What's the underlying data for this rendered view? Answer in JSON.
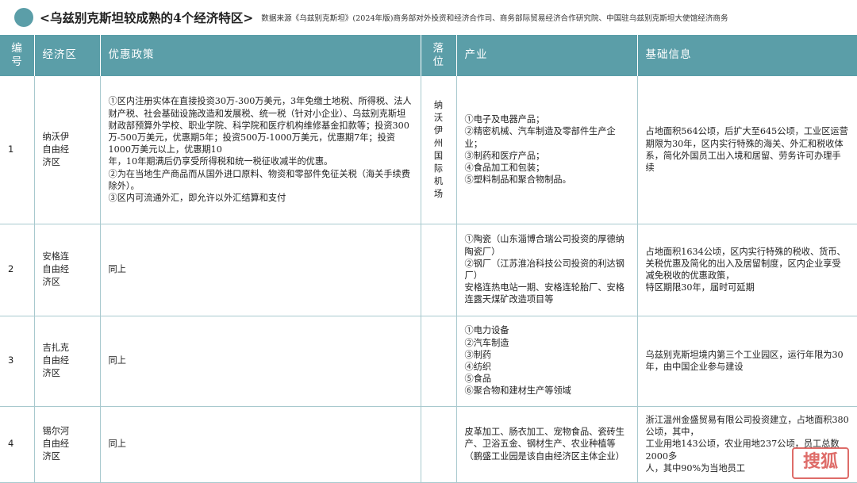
{
  "header": {
    "title": "<乌兹别克斯坦较成熟的4个经济特区>",
    "source": "数据来源《乌兹别克斯坦》(2024年版)商务部对外投资和经济合作司、商务部际贸易经济合作研究院、中国驻乌兹别克斯坦大使馆经济商务"
  },
  "columns": {
    "no": "编号",
    "zone": "经济区",
    "policy": "优惠政策",
    "location": "落位",
    "industry": "产业",
    "basic": "基础信息"
  },
  "rows": [
    {
      "no": "1",
      "zone": [
        "纳沃伊",
        "自由经",
        "济区"
      ],
      "policy": [
        "①区内注册实体在直接投资30万-300万美元，3年免缴土地税、所得税、法人财产税、社会基础设施改造和发展税、统一税（针对小企业）、乌兹别克斯坦财政部预算外学校、职业学院、科学院和医疗机构维修基金扣款等；投资300万-500万美元，优惠期5年；投资500万-1000万美元，优惠期7年；投资1000万美元以上，优惠期10",
        "年，10年期满后仍享受所得税和统一税征收减半的优惠。",
        "②为在当地生产商品而从国外进口原料、物资和零部件免征关税（海关手续费除外）。",
        "③区内可流通外汇，即允许以外汇结算和支付"
      ],
      "location": [
        "纳",
        "沃",
        "伊",
        "州",
        "国",
        "际",
        "机",
        "场"
      ],
      "industry": [
        "①电子及电器产品；",
        "②精密机械、汽车制造及零部件生产企业；",
        "③制药和医疗产品；",
        "④食品加工和包装；",
        "⑤塑料制品和聚合物制品。"
      ],
      "basic": [
        "占地面积564公顷，后扩大至645公顷，工业区运营期限为30年，区内实行特殊的海关、外汇和税收体系，简化外国员工出入境和居留、劳务许可办理手续"
      ]
    },
    {
      "no": "2",
      "zone": [
        "安格连",
        "自由经",
        "济区"
      ],
      "policy": [
        "同上"
      ],
      "location": [],
      "industry": [
        "①陶瓷（山东淄博合瑞公司投资的厚德纳陶瓷厂）",
        "②钢厂（江苏淮冶科技公司投资的利达钢厂）",
        "安格连热电站一期、安格连轮胎厂、安格连露天煤矿改造项目等"
      ],
      "basic": [
        "占地面积1634公顷，区内实行特殊的税收、货币、关税优惠及简化的出入及居留制度，区内企业享受减免税收的优惠政策，",
        "特区期限30年，届时可延期"
      ]
    },
    {
      "no": "3",
      "zone": [
        "吉扎克",
        "自由经",
        "济区"
      ],
      "policy": [
        "同上"
      ],
      "location": [],
      "industry": [
        "①电力设备",
        "②汽车制造",
        "③制药",
        "④纺织",
        "⑤食品",
        "⑥聚合物和建材生产等领域"
      ],
      "basic": [
        "乌兹别克斯坦境内第三个工业园区，运行年限为30年，由中国企业参与建设"
      ]
    },
    {
      "no": "4",
      "zone": [
        "锡尔河",
        "自由经",
        "济区"
      ],
      "policy": [
        "同上"
      ],
      "location": [],
      "industry": [
        "皮革加工、肠衣加工、宠物食品、瓷砖生产、卫浴五金、钢材生产、农业种植等（鹏盛工业园是该自由经济区主体企业）"
      ],
      "basic": [
        "浙江温州金盛贸易有限公司投资建立，占地面积380公顷，其中，",
        "工业用地143公顷，农业用地237公顷，员工总数2000多",
        "人，其中90%为当地员工"
      ]
    }
  ],
  "watermark": "搜狐"
}
